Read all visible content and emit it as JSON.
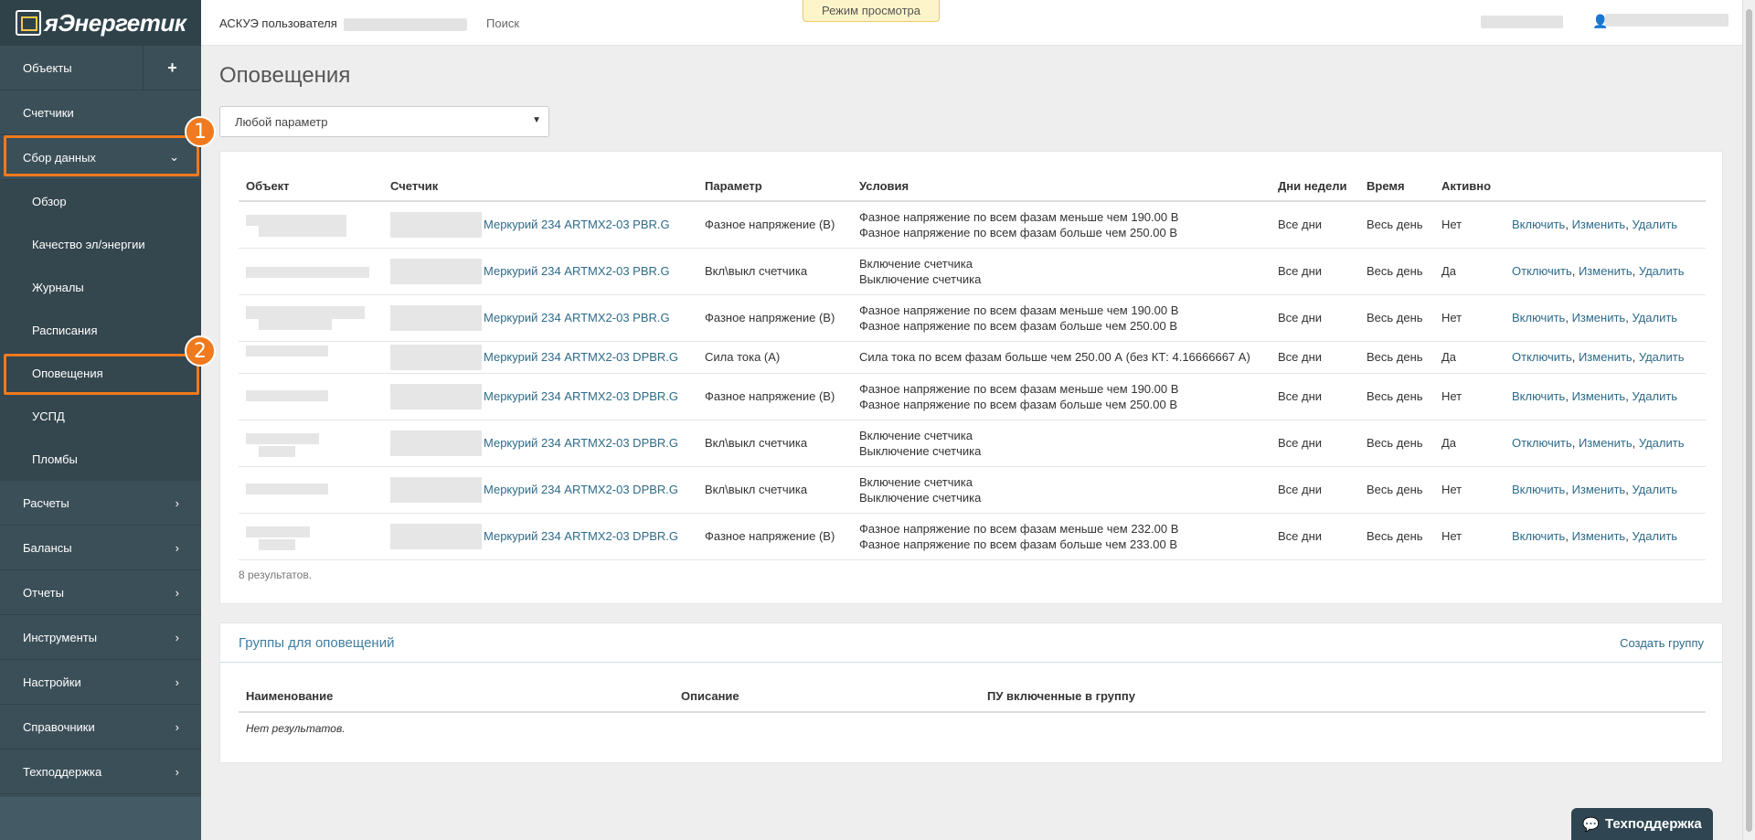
{
  "sidebar": {
    "logo_text": "яЭнергетик",
    "items": [
      {
        "label": "Объекты"
      },
      {
        "label": "Счетчики"
      },
      {
        "label": "Сбор данных"
      },
      {
        "label": "Расчеты"
      },
      {
        "label": "Балансы"
      },
      {
        "label": "Отчеты"
      },
      {
        "label": "Инструменты"
      },
      {
        "label": "Настройки"
      },
      {
        "label": "Справочники"
      },
      {
        "label": "Техподдержка"
      }
    ],
    "add_icon": "+",
    "submenu": [
      {
        "label": "Обзор"
      },
      {
        "label": "Качество эл/энергии"
      },
      {
        "label": "Журналы"
      },
      {
        "label": "Расписания"
      },
      {
        "label": "Оповещения"
      },
      {
        "label": "УСПД"
      },
      {
        "label": "Пломбы"
      }
    ],
    "annotations": [
      "1",
      "2"
    ],
    "accent_color": "#f07a1d"
  },
  "topbar": {
    "user_label": "АСКУЭ пользователя",
    "search_label": "Поиск",
    "view_mode": "Режим просмотра"
  },
  "page": {
    "title": "Оповещения",
    "filter_value": "Любой параметр"
  },
  "alerts": {
    "headers": [
      "Объект",
      "Счетчик",
      "Параметр",
      "Условия",
      "Дни недели",
      "Время",
      "Активно",
      ""
    ],
    "rows": [
      {
        "meter": "Меркурий 234 ARTMX2-03 PBR.G",
        "param": "Фазное напряжение (В)",
        "cond1": "Фазное напряжение по всем фазам меньше чем 190.00 В",
        "cond2": "Фазное напряжение по всем фазам больше чем 250.00 В",
        "days": "Все дни",
        "time": "Весь день",
        "active": "Нет",
        "act1": "Включить",
        "act2": "Изменить",
        "act3": "Удалить"
      },
      {
        "meter": "Меркурий 234 ARTMX2-03 PBR.G",
        "param": "Вкл\\выкл счетчика",
        "cond1": "Включение счетчика",
        "cond2": "Выключение счетчика",
        "days": "Все дни",
        "time": "Весь день",
        "active": "Да",
        "act1": "Отключить",
        "act2": "Изменить",
        "act3": "Удалить"
      },
      {
        "meter": "Меркурий 234 ARTMX2-03 PBR.G",
        "param": "Фазное напряжение (В)",
        "cond1": "Фазное напряжение по всем фазам меньше чем 190.00 В",
        "cond2": "Фазное напряжение по всем фазам больше чем 250.00 В",
        "days": "Все дни",
        "time": "Весь день",
        "active": "Нет",
        "act1": "Включить",
        "act2": "Изменить",
        "act3": "Удалить"
      },
      {
        "meter": "Меркурий 234 ARTMX2-03 DPBR.G",
        "param": "Сила тока (А)",
        "cond1": "Сила тока по всем фазам больше чем 250.00 А (без КТ: 4.16666667 А)",
        "cond2": "",
        "days": "Все дни",
        "time": "Весь день",
        "active": "Да",
        "act1": "Отключить",
        "act2": "Изменить",
        "act3": "Удалить"
      },
      {
        "meter": "Меркурий 234 ARTMX2-03 DPBR.G",
        "param": "Фазное напряжение (В)",
        "cond1": "Фазное напряжение по всем фазам меньше чем 190.00 В",
        "cond2": "Фазное напряжение по всем фазам больше чем 250.00 В",
        "days": "Все дни",
        "time": "Весь день",
        "active": "Нет",
        "act1": "Включить",
        "act2": "Изменить",
        "act3": "Удалить"
      },
      {
        "meter": "Меркурий 234 ARTMX2-03 DPBR.G",
        "param": "Вкл\\выкл счетчика",
        "cond1": "Включение счетчика",
        "cond2": "Выключение счетчика",
        "days": "Все дни",
        "time": "Весь день",
        "active": "Да",
        "act1": "Отключить",
        "act2": "Изменить",
        "act3": "Удалить"
      },
      {
        "meter": "Меркурий 234 ARTMX2-03 DPBR.G",
        "param": "Вкл\\выкл счетчика",
        "cond1": "Включение счетчика",
        "cond2": "Выключение счетчика",
        "days": "Все дни",
        "time": "Весь день",
        "active": "Нет",
        "act1": "Включить",
        "act2": "Изменить",
        "act3": "Удалить"
      },
      {
        "meter": "Меркурий 234 ARTMX2-03 DPBR.G",
        "param": "Фазное напряжение (В)",
        "cond1": "Фазное напряжение по всем фазам меньше чем 232.00 В",
        "cond2": "Фазное напряжение по всем фазам больше чем 233.00 В",
        "days": "Все дни",
        "time": "Весь день",
        "active": "Нет",
        "act1": "Включить",
        "act2": "Изменить",
        "act3": "Удалить"
      }
    ],
    "results": "8 результатов."
  },
  "groups": {
    "title": "Группы для оповещений",
    "create_label": "Создать группу",
    "headers": [
      "Наименование",
      "Описание",
      "ПУ включенные в группу"
    ],
    "empty": "Нет результатов."
  },
  "support": {
    "label": "Техподдержка",
    "icon": "chat-icon"
  }
}
